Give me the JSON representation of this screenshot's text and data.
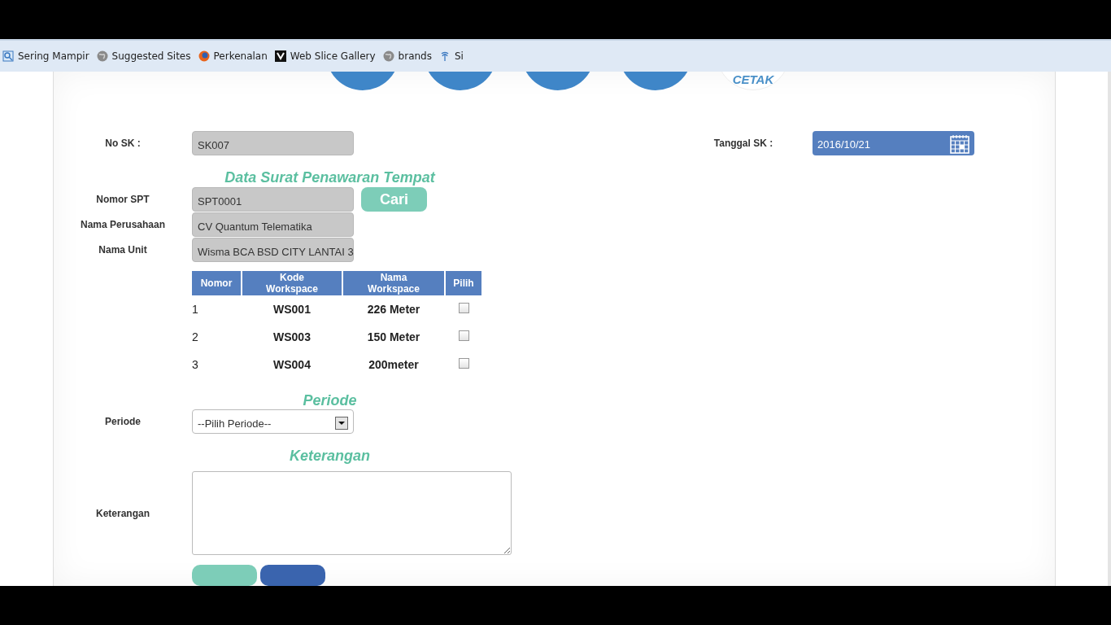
{
  "bookmarks": [
    {
      "label": "Sering Mampir",
      "kind": "search"
    },
    {
      "label": "Suggested Sites",
      "kind": "globe"
    },
    {
      "label": "Perkenalan",
      "kind": "browser"
    },
    {
      "label": "Web Slice Gallery",
      "kind": "slice"
    },
    {
      "label": "brands",
      "kind": "globe"
    },
    {
      "label": "Si",
      "kind": "palm"
    }
  ],
  "steps": [
    {
      "kind": "filled"
    },
    {
      "kind": "filled"
    },
    {
      "kind": "filled"
    },
    {
      "kind": "filled"
    },
    {
      "label": "CETAK",
      "kind": "outline"
    }
  ],
  "no_sk": {
    "label": "No SK :",
    "value": "SK007"
  },
  "tanggal_sk": {
    "label": "Tanggal SK :",
    "value": "2016/10/21"
  },
  "spt_heading": "Data Surat Penawaran Tempat",
  "spt_fields": [
    {
      "label": "Nomor SPT",
      "value": "SPT0001"
    },
    {
      "label": "Nama Perusahaan",
      "value": "CV Quantum Telematika"
    },
    {
      "label": "Nama Unit",
      "value": "Wisma BCA BSD CITY LANTAI 3"
    }
  ],
  "search_button": "Cari",
  "table": {
    "columns": [
      "Nomor",
      "Kode Workspace",
      "Nama Workspace",
      "Pilih"
    ],
    "rows": [
      {
        "nomor": "1",
        "kode": "WS001",
        "nama": "226 Meter",
        "checked": false
      },
      {
        "nomor": "2",
        "kode": "WS003",
        "nama": "150 Meter",
        "checked": false
      },
      {
        "nomor": "3",
        "kode": "WS004",
        "nama": "200meter",
        "checked": false
      }
    ]
  },
  "periode_heading": "Periode",
  "periode": {
    "label": "Periode",
    "value": "--Pilih Periode--"
  },
  "keterangan_heading": "Keterangan",
  "keterangan": {
    "label": "Keterangan"
  },
  "buttons": [
    {
      "kind": "green"
    },
    {
      "kind": "blue"
    }
  ]
}
